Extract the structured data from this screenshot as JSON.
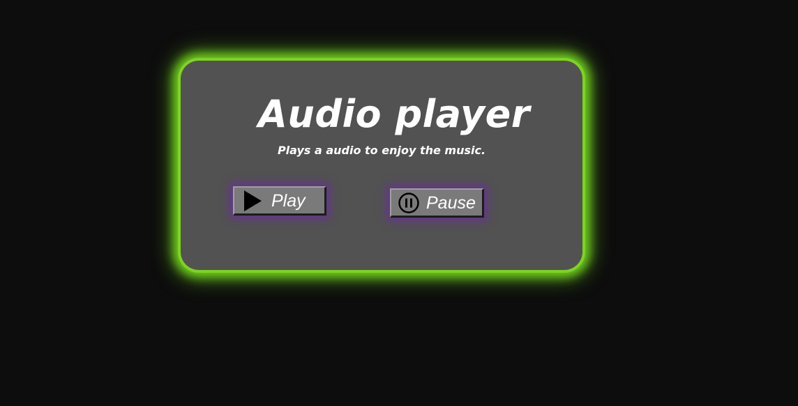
{
  "player": {
    "title": "Audio player",
    "subtitle": "Plays a audio to enjoy the music.",
    "play_label": "Play",
    "pause_label": "Pause",
    "play_icon": "play-icon",
    "pause_icon": "pause-circle-icon"
  },
  "colors": {
    "page_background": "#0d0d0d",
    "card_background": "#525252",
    "card_glow": "#7ed321",
    "button_background": "#7a7a7a",
    "button_glow": "#6e28aa",
    "text": "#ffffff"
  }
}
